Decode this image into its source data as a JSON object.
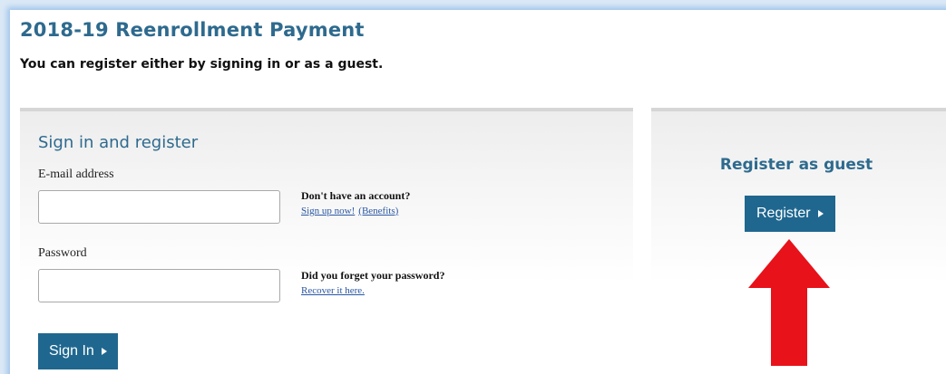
{
  "page": {
    "title": "2018-19 Reenrollment Payment",
    "subtitle": "You can register either by signing in or as a guest."
  },
  "signin": {
    "title": "Sign in and register",
    "email_label": "E-mail address",
    "email_value": "",
    "no_account_text": "Don't have an account?",
    "signup_link": "Sign up now!",
    "benefits_link": "(Benefits)",
    "password_label": "Password",
    "password_value": "",
    "forgot_text": "Did you forget your password?",
    "recover_link": "Recover it here.",
    "button_label": "Sign In"
  },
  "guest": {
    "title": "Register as guest",
    "button_label": "Register"
  },
  "colors": {
    "accent": "#1f678f",
    "heading": "#2e6a8e",
    "link": "#2a57a3",
    "arrow": "#e8121a",
    "frame_glow": "#9ec4ea"
  },
  "icons": {
    "button_arrow": "triangle-right-icon",
    "annotation": "red-up-arrow"
  }
}
